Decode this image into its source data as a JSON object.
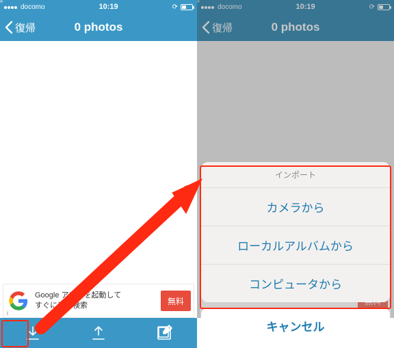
{
  "status": {
    "carrier": "docomo",
    "time": "10:19",
    "battery_pct": 40
  },
  "nav": {
    "back_label": "復帰",
    "title": "0 photos"
  },
  "ad": {
    "logo_letter": "G",
    "line1": "Google アプリを起動して",
    "line2": "すぐに音声検索",
    "cta": "無料"
  },
  "toolbar": {
    "import_icon": "download-icon",
    "export_icon": "upload-icon",
    "edit_icon": "compose-icon"
  },
  "sheet": {
    "title": "インポート",
    "options": [
      "カメラから",
      "ローカルアルバムから",
      "コンピュータから"
    ],
    "cancel": "キャンセル"
  }
}
